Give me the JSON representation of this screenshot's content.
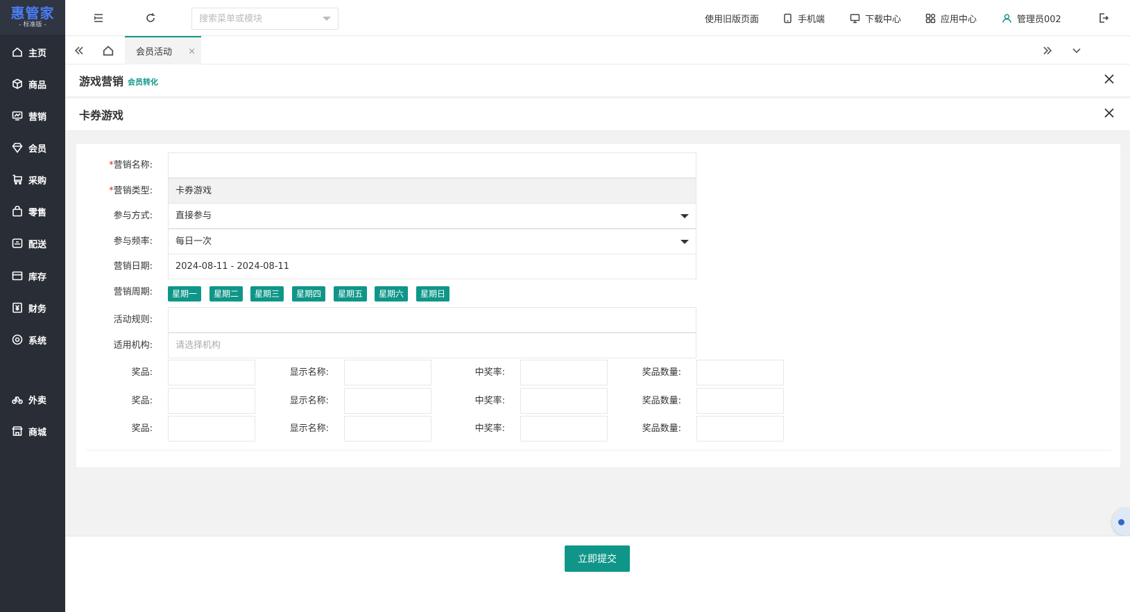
{
  "sidebar": {
    "logo": "惠管家",
    "logo_sub": "- 标准版 -",
    "items": [
      {
        "label": "主页",
        "icon": "home-icon"
      },
      {
        "label": "商品",
        "icon": "box-icon"
      },
      {
        "label": "营销",
        "icon": "chart-icon"
      },
      {
        "label": "会员",
        "icon": "diamond-icon"
      },
      {
        "label": "采购",
        "icon": "cart-icon"
      },
      {
        "label": "零售",
        "icon": "bag-icon"
      },
      {
        "label": "配送",
        "icon": "truck-icon"
      },
      {
        "label": "库存",
        "icon": "inventory-icon"
      },
      {
        "label": "财务",
        "icon": "yen-icon"
      },
      {
        "label": "系统",
        "icon": "target-icon"
      },
      {
        "label": "外卖",
        "icon": "bike-icon"
      },
      {
        "label": "商城",
        "icon": "shop-icon"
      }
    ]
  },
  "topbar": {
    "search_placeholder": "搜索菜单或模块",
    "old_version": "使用旧版页面",
    "mobile": "手机端",
    "download": "下载中心",
    "apps": "应用中心",
    "user": "管理员002"
  },
  "tabs": {
    "active_tab": "会员活动",
    "close": "×"
  },
  "header1": {
    "title": "游戏营销",
    "subtitle": "会员转化"
  },
  "header2": {
    "title": "卡券游戏"
  },
  "form": {
    "name_label": "营销名称:",
    "name_value": "",
    "type_label": "营销类型:",
    "type_value": "卡券游戏",
    "mode_label": "参与方式:",
    "mode_value": "直接参与",
    "freq_label": "参与频率:",
    "freq_value": "每日一次",
    "date_label": "营销日期:",
    "date_value": "2024-08-11 - 2024-08-11",
    "cycle_label": "营销周期:",
    "days": [
      "星期一",
      "星期二",
      "星期三",
      "星期四",
      "星期五",
      "星期六",
      "星期日"
    ],
    "rule_label": "活动规则:",
    "rule_value": "",
    "org_label": "适用机构:",
    "org_placeholder": "请选择机构",
    "prize_label": "奖品:",
    "display_label": "显示名称:",
    "rate_label": "中奖率:",
    "qty_label": "奖品数量:",
    "required_mark": "*"
  },
  "footer": {
    "submit": "立即提交"
  },
  "colors": {
    "accent": "#0f9688",
    "sidebar_bg": "#282d36",
    "logo_blue": "#4b7cf5"
  }
}
